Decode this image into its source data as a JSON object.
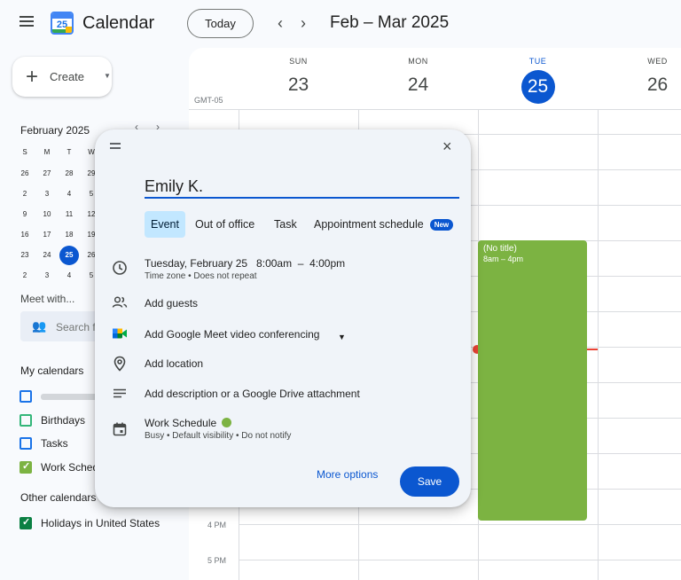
{
  "header": {
    "app_title": "Calendar",
    "logo_day": "25",
    "today_label": "Today",
    "prev_icon": "‹",
    "next_icon": "›",
    "date_range": "Feb – Mar 2025"
  },
  "sidebar": {
    "create_label": "Create",
    "mini_calendar": {
      "title": "February 2025",
      "days_of_week": [
        "S",
        "M",
        "T",
        "W"
      ],
      "weeks": [
        [
          "26",
          "27",
          "28",
          "29"
        ],
        [
          "2",
          "3",
          "4",
          "5"
        ],
        [
          "9",
          "10",
          "11",
          "12"
        ],
        [
          "16",
          "17",
          "18",
          "19"
        ],
        [
          "23",
          "24",
          "25",
          "26"
        ],
        [
          "2",
          "3",
          "4",
          "5"
        ]
      ],
      "selected": "25"
    },
    "meet_with_label": "Meet with...",
    "search_people_placeholder": "Search f",
    "my_calendars_title": "My calendars",
    "my_calendars": [
      {
        "label": "",
        "color": "#1a73e8",
        "checked": false
      },
      {
        "label": "Birthdays",
        "color": "#33b679",
        "checked": false
      },
      {
        "label": "Tasks",
        "color": "#1a73e8",
        "checked": false
      },
      {
        "label": "Work Sched",
        "color": "#7cb342",
        "checked": true
      }
    ],
    "other_calendars_title": "Other calendars",
    "other_calendars": [
      {
        "label": "Holidays in United States",
        "color": "#0b8043",
        "checked": true
      }
    ]
  },
  "grid": {
    "timezone": "GMT-05",
    "days": [
      {
        "dow": "SUN",
        "dom": "23"
      },
      {
        "dow": "MON",
        "dom": "24"
      },
      {
        "dow": "TUE",
        "dom": "25",
        "today": true
      },
      {
        "dow": "WED",
        "dom": "26"
      }
    ],
    "time_labels": [
      "4 PM",
      "5 PM"
    ],
    "event": {
      "title": "(No title)",
      "time": "8am – 4pm",
      "color": "#7cb342"
    }
  },
  "dialog": {
    "title_value": "Emily K.",
    "tabs": [
      "Event",
      "Out of office",
      "Task",
      "Appointment schedule"
    ],
    "new_badge": "New",
    "datetime": "Tuesday, February 25   8:00am  –  4:00pm",
    "datetime_sub": "Time zone • Does not repeat",
    "add_guests": "Add guests",
    "add_meet": "Add Google Meet video conferencing",
    "add_location": "Add location",
    "add_description": "Add description or a Google Drive attachment",
    "calendar_name": "Work Schedule",
    "calendar_sub": "Busy • Default visibility • Do not notify",
    "more_options": "More options",
    "save": "Save",
    "close_icon": "×"
  }
}
